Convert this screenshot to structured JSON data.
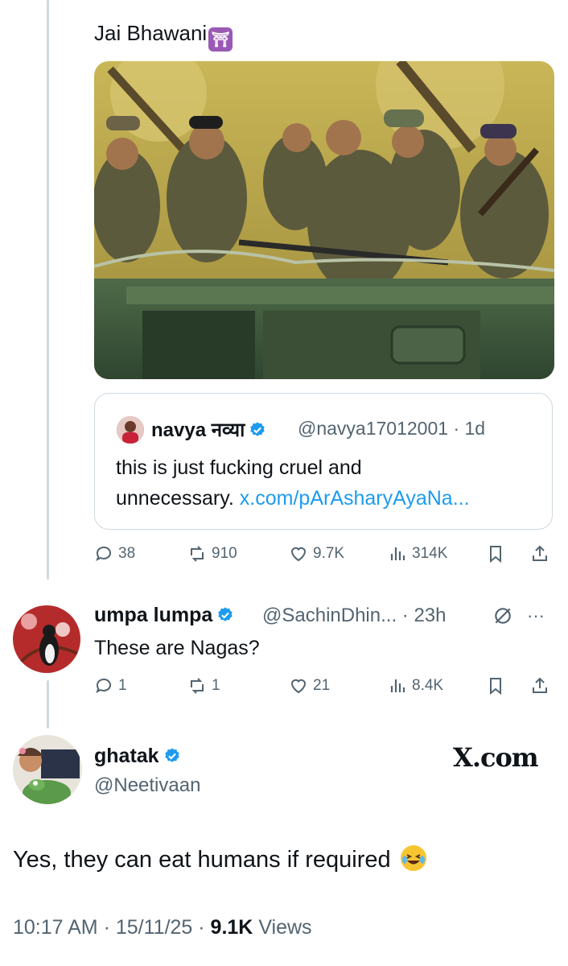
{
  "parent_tweet": {
    "text": "Jai Bhawani",
    "emoji": "🛕",
    "image_alt": "photo-of-soldiers-on-vehicle",
    "quote": {
      "name": "navya नव्या",
      "handle": "@navya17012001",
      "age": "1d",
      "text": "this is just fucking cruel and",
      "text2": "unnecessary.",
      "link": "x.com/pArAsharyAyaNa..."
    },
    "actions": {
      "replies": "38",
      "reposts": "910",
      "likes": "9.7K",
      "views": "314K"
    }
  },
  "reply": {
    "name": "umpa lumpa",
    "handle": "@SachinDhin...",
    "age": "23h",
    "text": "These are Nagas?",
    "actions": {
      "replies": "1",
      "reposts": "1",
      "likes": "21",
      "views": "8.4K"
    }
  },
  "main_tweet": {
    "name": "ghatak",
    "handle": "@Neetivaan",
    "brand": "X.com",
    "text": "Yes, they can eat humans if required",
    "time": "10:17 AM",
    "date": "15/11/25",
    "views_count": "9.1K",
    "views_label": "Views"
  },
  "colors": {
    "accent": "#1d9bf0",
    "muted": "#536471",
    "line": "#cfd9de"
  }
}
